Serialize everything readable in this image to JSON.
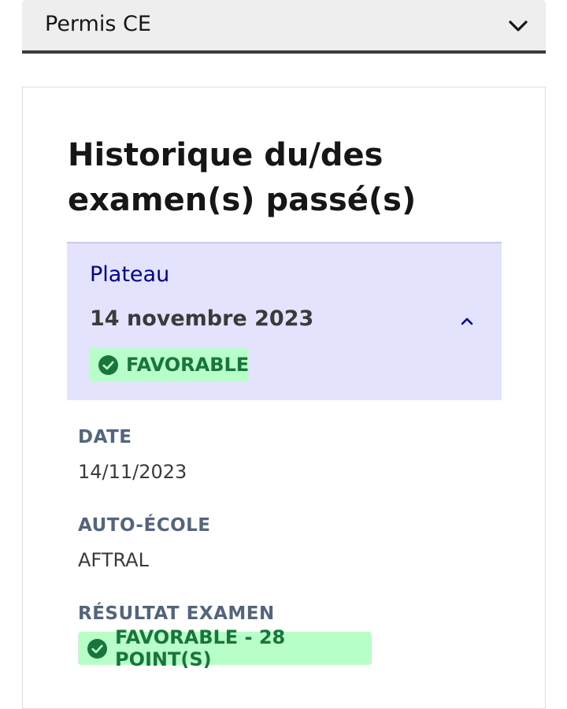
{
  "license_select": {
    "selected": "Permis CE",
    "icon": "chevron-down-icon"
  },
  "history": {
    "title": "Historique du/des examen(s) passé(s)",
    "exam": {
      "type": "Plateau",
      "date_heading": "14 novembre 2023",
      "status_badge": "FAVORABLE",
      "expanded": true,
      "details": {
        "date_label": "DATE",
        "date_value": "14/11/2023",
        "school_label": "AUTO-ÉCOLE",
        "school_value": "AFTRAL",
        "result_label": "RÉSULTAT EXAMEN",
        "result_badge": "FAVORABLE - 28 POINT(S)"
      }
    }
  },
  "colors": {
    "accent": "#000091",
    "success_bg": "#b8fec9",
    "success_text": "#18753c",
    "accordion_bg": "#e3e3fd",
    "label": "#53657d"
  }
}
